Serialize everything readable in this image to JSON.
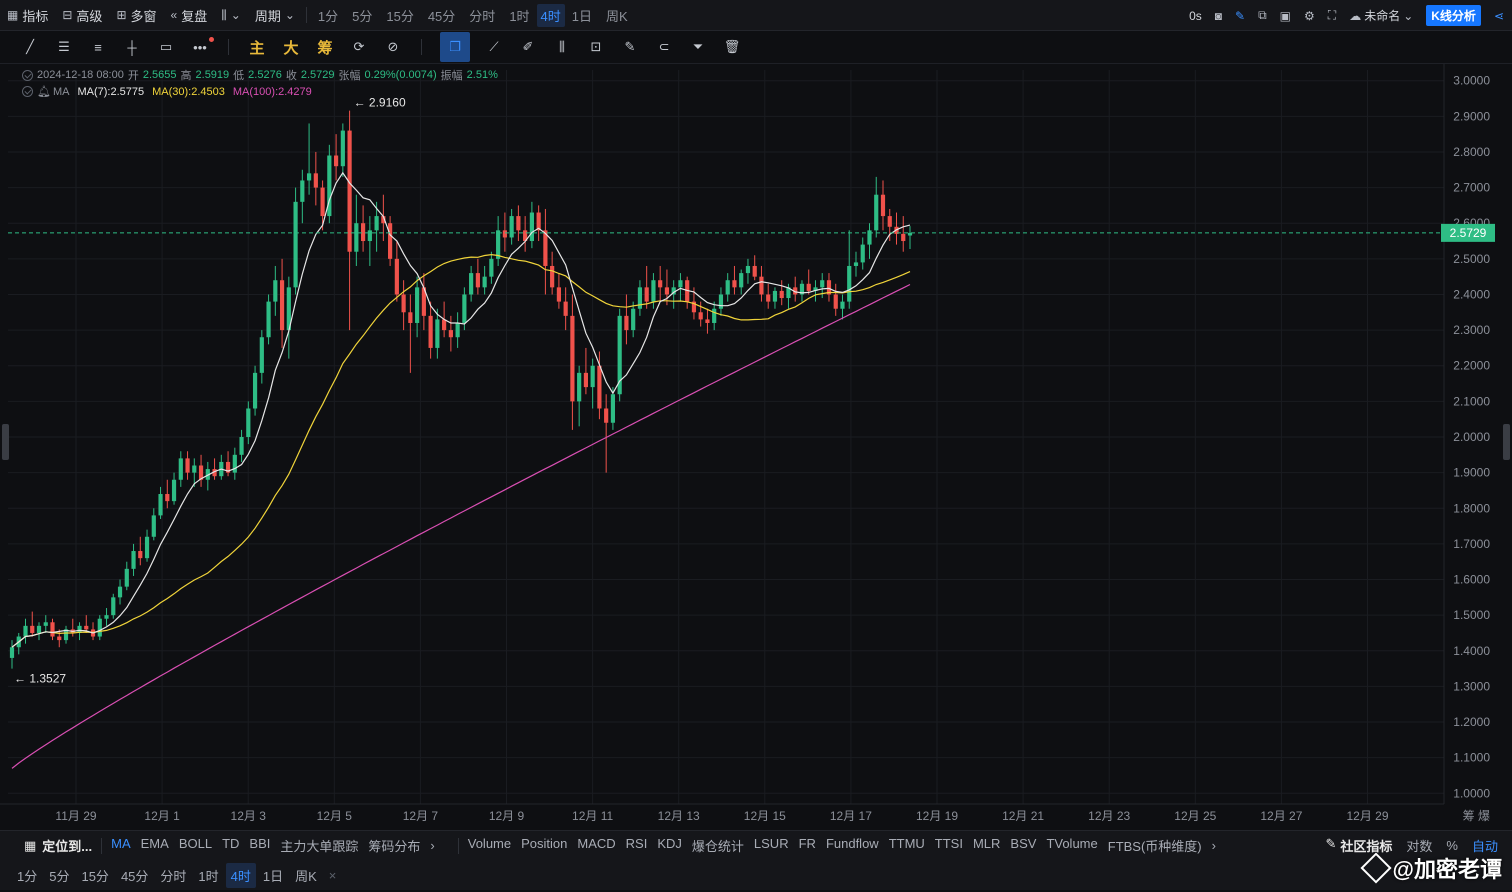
{
  "topbar": {
    "indicator_label": "指标",
    "advanced_label": "高级",
    "multi_window_label": "多窗",
    "replay_label": "复盘",
    "period_label": "周期",
    "periods": [
      "1分",
      "5分",
      "15分",
      "45分",
      "分时",
      "1时",
      "4时",
      "1日",
      "周K"
    ],
    "active_period": "4时",
    "countdown": "0s",
    "layout_name": "未命名",
    "k_analysis_label": "K线分析"
  },
  "drawing_tools": {
    "main_label": "主",
    "big_label": "大",
    "chips_label": "筹"
  },
  "ohlc": {
    "datetime": "2024-12-18 08:00",
    "open_label": "开",
    "open": "2.5655",
    "high_label": "高",
    "high": "2.5919",
    "low_label": "低",
    "low": "2.5276",
    "close_label": "收",
    "close": "2.5729",
    "change_label": "张幅",
    "change": "0.29%(0.0074)",
    "amp_label": "振幅",
    "amp": "2.51%"
  },
  "ma_legend": {
    "name": "MA",
    "ma7": "MA(7):2.5775",
    "ma30": "MA(30):2.4503",
    "ma100": "MA(100):2.4279",
    "ma7_color": "#e6e6e6",
    "ma30_color": "#f0d43a",
    "ma100_color": "#d94fb3"
  },
  "colors": {
    "up": "#2ebd85",
    "down": "#f0524b",
    "accent": "#1677ff",
    "price_tag": "#2ebd85"
  },
  "chart_data": {
    "type": "candlestick",
    "ylim": [
      0.97,
      3.03
    ],
    "y_ticks": [
      "3.0000",
      "2.9000",
      "2.8000",
      "2.7000",
      "2.6000",
      "2.5000",
      "2.4000",
      "2.3000",
      "2.2000",
      "2.1000",
      "2.0000",
      "1.9000",
      "1.8000",
      "1.7000",
      "1.6000",
      "1.5000",
      "1.4000",
      "1.3000",
      "1.2000",
      "1.1000",
      "1.0000"
    ],
    "x_ticks": [
      "11月 29",
      "12月 1",
      "12月 3",
      "12月 5",
      "12月 7",
      "12月 9",
      "12月 11",
      "12月 13",
      "12月 15",
      "12月 17",
      "12月 19",
      "12月 21",
      "12月 23",
      "12月 25",
      "12月 27",
      "12月 29"
    ],
    "axis_corner": "筹  爆",
    "last_price": "2.5729",
    "high_marker": "← 2.9160",
    "low_marker": "← 1.3527",
    "candles": [
      [
        1.38,
        1.43,
        1.35,
        1.41
      ],
      [
        1.41,
        1.45,
        1.39,
        1.44
      ],
      [
        1.44,
        1.49,
        1.42,
        1.47
      ],
      [
        1.47,
        1.51,
        1.44,
        1.45
      ],
      [
        1.45,
        1.48,
        1.43,
        1.47
      ],
      [
        1.47,
        1.5,
        1.45,
        1.48
      ],
      [
        1.48,
        1.49,
        1.43,
        1.44
      ],
      [
        1.44,
        1.46,
        1.41,
        1.43
      ],
      [
        1.43,
        1.47,
        1.42,
        1.46
      ],
      [
        1.46,
        1.49,
        1.44,
        1.45
      ],
      [
        1.45,
        1.48,
        1.43,
        1.47
      ],
      [
        1.47,
        1.5,
        1.45,
        1.46
      ],
      [
        1.46,
        1.48,
        1.43,
        1.44
      ],
      [
        1.44,
        1.5,
        1.43,
        1.49
      ],
      [
        1.49,
        1.52,
        1.47,
        1.5
      ],
      [
        1.5,
        1.56,
        1.49,
        1.55
      ],
      [
        1.55,
        1.6,
        1.53,
        1.58
      ],
      [
        1.58,
        1.65,
        1.57,
        1.63
      ],
      [
        1.63,
        1.7,
        1.61,
        1.68
      ],
      [
        1.68,
        1.72,
        1.64,
        1.66
      ],
      [
        1.66,
        1.74,
        1.65,
        1.72
      ],
      [
        1.72,
        1.8,
        1.71,
        1.78
      ],
      [
        1.78,
        1.86,
        1.77,
        1.84
      ],
      [
        1.84,
        1.88,
        1.8,
        1.82
      ],
      [
        1.82,
        1.9,
        1.81,
        1.88
      ],
      [
        1.88,
        1.96,
        1.86,
        1.94
      ],
      [
        1.94,
        1.96,
        1.88,
        1.9
      ],
      [
        1.9,
        1.94,
        1.86,
        1.92
      ],
      [
        1.92,
        1.95,
        1.86,
        1.88
      ],
      [
        1.88,
        1.93,
        1.85,
        1.91
      ],
      [
        1.91,
        1.94,
        1.88,
        1.89
      ],
      [
        1.89,
        1.95,
        1.88,
        1.93
      ],
      [
        1.93,
        1.96,
        1.89,
        1.9
      ],
      [
        1.9,
        1.97,
        1.88,
        1.95
      ],
      [
        1.95,
        2.02,
        1.93,
        2.0
      ],
      [
        2.0,
        2.1,
        1.98,
        2.08
      ],
      [
        2.08,
        2.2,
        2.06,
        2.18
      ],
      [
        2.18,
        2.3,
        2.15,
        2.28
      ],
      [
        2.28,
        2.4,
        2.26,
        2.38
      ],
      [
        2.38,
        2.48,
        2.34,
        2.44
      ],
      [
        2.44,
        2.5,
        2.25,
        2.3
      ],
      [
        2.3,
        2.45,
        2.22,
        2.42
      ],
      [
        2.42,
        2.7,
        2.4,
        2.66
      ],
      [
        2.66,
        2.75,
        2.6,
        2.72
      ],
      [
        2.72,
        2.88,
        2.68,
        2.74
      ],
      [
        2.74,
        2.8,
        2.65,
        2.7
      ],
      [
        2.7,
        2.72,
        2.58,
        2.62
      ],
      [
        2.62,
        2.82,
        2.6,
        2.79
      ],
      [
        2.79,
        2.85,
        2.72,
        2.76
      ],
      [
        2.76,
        2.88,
        2.73,
        2.86
      ],
      [
        2.86,
        2.916,
        2.3,
        2.52
      ],
      [
        2.52,
        2.68,
        2.48,
        2.6
      ],
      [
        2.6,
        2.65,
        2.52,
        2.55
      ],
      [
        2.55,
        2.62,
        2.48,
        2.58
      ],
      [
        2.58,
        2.66,
        2.52,
        2.62
      ],
      [
        2.62,
        2.68,
        2.55,
        2.6
      ],
      [
        2.6,
        2.62,
        2.48,
        2.5
      ],
      [
        2.5,
        2.55,
        2.38,
        2.4
      ],
      [
        2.4,
        2.44,
        2.3,
        2.35
      ],
      [
        2.35,
        2.4,
        2.18,
        2.32
      ],
      [
        2.32,
        2.45,
        2.28,
        2.42
      ],
      [
        2.42,
        2.46,
        2.3,
        2.34
      ],
      [
        2.34,
        2.38,
        2.22,
        2.25
      ],
      [
        2.25,
        2.36,
        2.22,
        2.33
      ],
      [
        2.33,
        2.38,
        2.28,
        2.3
      ],
      [
        2.3,
        2.34,
        2.24,
        2.28
      ],
      [
        2.28,
        2.35,
        2.25,
        2.32
      ],
      [
        2.32,
        2.42,
        2.3,
        2.4
      ],
      [
        2.4,
        2.48,
        2.38,
        2.46
      ],
      [
        2.46,
        2.5,
        2.4,
        2.42
      ],
      [
        2.42,
        2.48,
        2.4,
        2.45
      ],
      [
        2.45,
        2.52,
        2.43,
        2.5
      ],
      [
        2.5,
        2.62,
        2.48,
        2.58
      ],
      [
        2.58,
        2.63,
        2.52,
        2.56
      ],
      [
        2.56,
        2.64,
        2.54,
        2.62
      ],
      [
        2.62,
        2.65,
        2.55,
        2.58
      ],
      [
        2.58,
        2.62,
        2.52,
        2.55
      ],
      [
        2.55,
        2.66,
        2.53,
        2.63
      ],
      [
        2.63,
        2.65,
        2.55,
        2.58
      ],
      [
        2.58,
        2.64,
        2.4,
        2.48
      ],
      [
        2.48,
        2.52,
        2.4,
        2.42
      ],
      [
        2.42,
        2.46,
        2.36,
        2.38
      ],
      [
        2.38,
        2.42,
        2.3,
        2.34
      ],
      [
        2.34,
        2.4,
        2.02,
        2.1
      ],
      [
        2.1,
        2.2,
        2.03,
        2.18
      ],
      [
        2.18,
        2.25,
        2.12,
        2.14
      ],
      [
        2.14,
        2.22,
        2.08,
        2.2
      ],
      [
        2.2,
        2.24,
        2.05,
        2.08
      ],
      [
        2.08,
        2.12,
        1.9,
        2.04
      ],
      [
        2.04,
        2.14,
        2.02,
        2.12
      ],
      [
        2.12,
        2.36,
        2.1,
        2.34
      ],
      [
        2.34,
        2.4,
        2.26,
        2.3
      ],
      [
        2.3,
        2.38,
        2.28,
        2.36
      ],
      [
        2.36,
        2.44,
        2.34,
        2.42
      ],
      [
        2.42,
        2.48,
        2.36,
        2.38
      ],
      [
        2.38,
        2.46,
        2.36,
        2.44
      ],
      [
        2.44,
        2.48,
        2.38,
        2.42
      ],
      [
        2.42,
        2.47,
        2.37,
        2.4
      ],
      [
        2.4,
        2.44,
        2.36,
        2.42
      ],
      [
        2.42,
        2.46,
        2.38,
        2.44
      ],
      [
        2.44,
        2.45,
        2.36,
        2.38
      ],
      [
        2.38,
        2.42,
        2.33,
        2.35
      ],
      [
        2.35,
        2.38,
        2.31,
        2.33
      ],
      [
        2.33,
        2.36,
        2.29,
        2.32
      ],
      [
        2.32,
        2.38,
        2.3,
        2.36
      ],
      [
        2.36,
        2.42,
        2.34,
        2.4
      ],
      [
        2.4,
        2.46,
        2.38,
        2.44
      ],
      [
        2.44,
        2.48,
        2.4,
        2.42
      ],
      [
        2.42,
        2.47,
        2.4,
        2.46
      ],
      [
        2.46,
        2.5,
        2.43,
        2.48
      ],
      [
        2.48,
        2.51,
        2.44,
        2.45
      ],
      [
        2.45,
        2.48,
        2.38,
        2.4
      ],
      [
        2.4,
        2.43,
        2.36,
        2.38
      ],
      [
        2.38,
        2.42,
        2.36,
        2.41
      ],
      [
        2.41,
        2.44,
        2.37,
        2.39
      ],
      [
        2.39,
        2.43,
        2.36,
        2.42
      ],
      [
        2.42,
        2.45,
        2.38,
        2.4
      ],
      [
        2.4,
        2.44,
        2.38,
        2.43
      ],
      [
        2.43,
        2.47,
        2.4,
        2.41
      ],
      [
        2.41,
        2.44,
        2.38,
        2.42
      ],
      [
        2.42,
        2.46,
        2.39,
        2.44
      ],
      [
        2.44,
        2.46,
        2.38,
        2.4
      ],
      [
        2.4,
        2.43,
        2.34,
        2.36
      ],
      [
        2.36,
        2.4,
        2.33,
        2.38
      ],
      [
        2.38,
        2.58,
        2.36,
        2.48
      ],
      [
        2.48,
        2.52,
        2.45,
        2.49
      ],
      [
        2.49,
        2.56,
        2.47,
        2.54
      ],
      [
        2.54,
        2.6,
        2.5,
        2.58
      ],
      [
        2.58,
        2.73,
        2.56,
        2.68
      ],
      [
        2.68,
        2.72,
        2.58,
        2.62
      ],
      [
        2.62,
        2.64,
        2.55,
        2.59
      ],
      [
        2.59,
        2.63,
        2.54,
        2.57
      ],
      [
        2.57,
        2.62,
        2.52,
        2.55
      ],
      [
        2.5655,
        2.5919,
        2.5276,
        2.5729
      ]
    ]
  },
  "bottom_indicators": {
    "locate_label": "定位到...",
    "main_items": [
      "MA",
      "EMA",
      "BOLL",
      "TD",
      "BBI",
      "主力大单跟踪",
      "筹码分布"
    ],
    "active_main": "MA",
    "sub_items": [
      "Volume",
      "Position",
      "MACD",
      "RSI",
      "KDJ",
      "爆仓统计",
      "LSUR",
      "FR",
      "Fundflow",
      "TTMU",
      "TTSI",
      "MLR",
      "BSV",
      "TVolume",
      "FTBS(币种维度)"
    ],
    "community_label": "社区指标",
    "log_label": "对数",
    "percent_label": "%",
    "auto_label": "自动"
  },
  "bottom_periods": {
    "items": [
      "1分",
      "5分",
      "15分",
      "45分",
      "分时",
      "1时",
      "4时",
      "1日",
      "周K"
    ],
    "active": "4时",
    "close_icon": "×"
  },
  "watermark": "@加密老谭"
}
